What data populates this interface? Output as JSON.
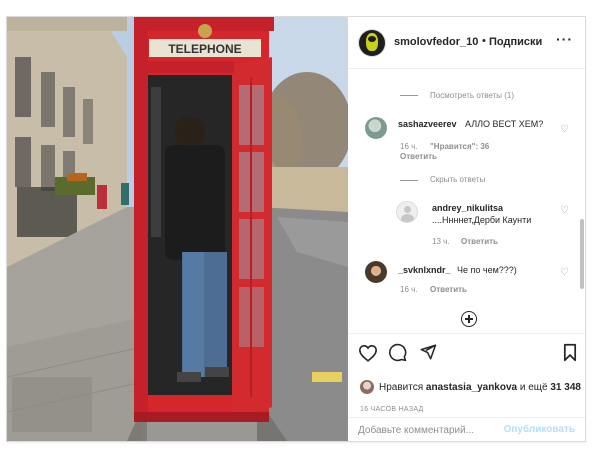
{
  "post": {
    "username": "smolovfedor_10",
    "separator": "•",
    "follow_label": "Подписки",
    "more_icon": "more-horizontal-icon",
    "photo_sign_text": "TELEPHONE"
  },
  "comments": {
    "view_replies_1": "Посмотреть ответы (1)",
    "items": [
      {
        "username": "sashazveerev",
        "text": "АЛЛО ВЕСТ ХЕМ?",
        "time": "16 ч.",
        "likes": "\"Нравится\": 36",
        "reply": "Ответить"
      },
      {
        "username": "andrey_nikulitsa",
        "text": "....Ннннет,Дерби Каунти",
        "time": "13 ч.",
        "reply": "Ответить"
      },
      {
        "username": "_svknlxndr_",
        "text": "Че по чем???)",
        "time": "16 ч.",
        "reply": "Ответить"
      }
    ],
    "hide_replies": "Скрыть ответы"
  },
  "actions": {
    "likes_prefix": "Нравится",
    "likes_user": "anastasia_yankova",
    "likes_suffix": "и ещё",
    "likes_count": "31 348",
    "time_ago": "16 ЧАСОВ НАЗАД",
    "comment_placeholder": "Добавьте комментарий...",
    "publish_label": "Опубликовать"
  },
  "colors": {
    "booth_red": "#d5262b",
    "link_blue": "#b2dffc",
    "muted_gray": "#8e8e8e"
  }
}
